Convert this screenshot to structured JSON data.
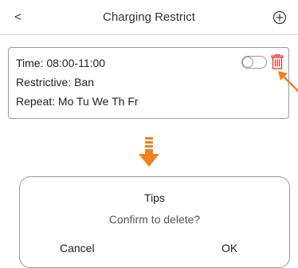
{
  "header": {
    "back_label": "<",
    "title": "Charging Restrict"
  },
  "restriction": {
    "time": "Time: 08:00-11:00",
    "restrictive": "Restrictive: Ban",
    "repeat": "Repeat: Mo Tu We Th Fr",
    "enabled": false
  },
  "dialog": {
    "title": "Tips",
    "message": "Confirm to delete?",
    "cancel_label": "Cancel",
    "ok_label": "OK"
  },
  "colors": {
    "accent": "#f08020",
    "delete": "#e53935",
    "border": "#9a9a9a"
  },
  "icons": {
    "add": "add-circle-icon",
    "delete": "trash-icon",
    "annotation_pointer": "arrow-icon",
    "step_arrow": "down-arrow-icon"
  }
}
